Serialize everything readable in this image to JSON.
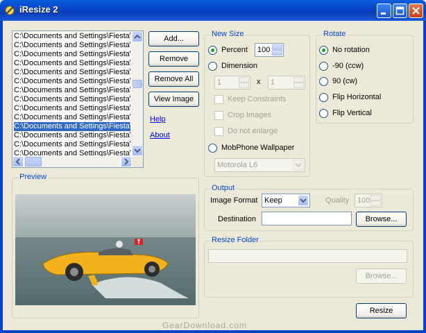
{
  "window": {
    "title": "iResize 2"
  },
  "files": {
    "items": [
      "C:\\Documents and Settings\\Fiesta\\",
      "C:\\Documents and Settings\\Fiesta\\",
      "C:\\Documents and Settings\\Fiesta\\",
      "C:\\Documents and Settings\\Fiesta\\",
      "C:\\Documents and Settings\\Fiesta\\",
      "C:\\Documents and Settings\\Fiesta\\",
      "C:\\Documents and Settings\\Fiesta\\",
      "C:\\Documents and Settings\\Fiesta\\",
      "C:\\Documents and Settings\\Fiesta\\",
      "C:\\Documents and Settings\\Fiesta\\",
      "C:\\Documents and Settings\\Fiesta\\",
      "C:\\Documents and Settings\\Fiesta\\",
      "C:\\Documents and Settings\\Fiesta\\",
      "C:\\Documents and Settings\\Fiesta\\"
    ],
    "selected_index": 10
  },
  "actions": {
    "add": "Add...",
    "remove": "Remove",
    "remove_all": "Remove All",
    "view_image": "View Image",
    "help": "Help",
    "about": "About"
  },
  "new_size": {
    "legend": "New Size",
    "percent_label": "Percent",
    "percent_value": "100",
    "dimension_label": "Dimension",
    "width_value": "1",
    "height_value": "1",
    "x_label": "x",
    "keep_constraints": "Keep Constraints",
    "crop_images": "Crop Images",
    "do_not_enlarge": "Do not enlarge",
    "mobphone_label": "MobPhone Wallpaper",
    "mobphone_model": "Motorola L6"
  },
  "rotate": {
    "legend": "Rotate",
    "options": [
      "No rotation",
      "-90 (ccw)",
      "90 (cw)",
      "Flip Horizontal",
      "Flip Vertical"
    ],
    "selected_index": 0
  },
  "preview": {
    "legend": "Preview"
  },
  "output": {
    "legend": "Output",
    "format_label": "Image Format",
    "format_value": "Keep",
    "quality_label": "Quality",
    "quality_value": "100",
    "destination_label": "Destination",
    "destination_value": "",
    "browse": "Browse..."
  },
  "resize_folder": {
    "legend": "Resize Folder",
    "path_value": "",
    "browse": "Browse..."
  },
  "footer": {
    "resize": "Resize",
    "watermark": "GearDownload.com"
  },
  "colors": {
    "titlebar": "#0a3fb8",
    "legend_text": "#0046d5",
    "selection": "#316ac5",
    "radio_dot": "#21a121",
    "car_body": "#f2b21c"
  }
}
